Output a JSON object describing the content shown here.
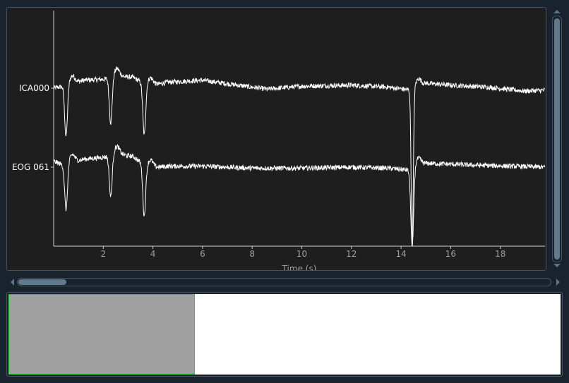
{
  "colors": {
    "background": "#19232d",
    "plot_background": "#1e1e1e",
    "trace": "#ffffff",
    "axis": "#d0d0d0",
    "tick_label": "#a0a0a0",
    "scroll_handle": "#60798b",
    "overview_window": "#a0a0a0",
    "overview_window_border": "#2ecc40"
  },
  "chart_data": {
    "type": "line",
    "xlabel": "Time (s)",
    "xlim": [
      0,
      19.8
    ],
    "xticks": [
      2,
      4,
      6,
      8,
      10,
      12,
      14,
      16,
      18
    ],
    "channels": [
      "ICA000",
      "EOG 061"
    ],
    "series": [
      {
        "name": "ICA000",
        "baseline_segments": [
          {
            "x": [
              0,
              0.4,
              1.2,
              2.0,
              2.6,
              3.2,
              3.8,
              4.6,
              6,
              8,
              8.6,
              10,
              12,
              13.5,
              14.4,
              15,
              16,
              17.5,
              19,
              19.8
            ],
            "y": [
              0.0,
              0.1,
              0.4,
              0.45,
              0.6,
              0.55,
              0.1,
              0.3,
              0.4,
              0.05,
              -0.05,
              0.1,
              0.15,
              0.05,
              -0.1,
              0.25,
              0.15,
              0.05,
              -0.15,
              -0.1
            ]
          }
        ],
        "blinks": [
          {
            "t": 0.5,
            "depth": -2.6
          },
          {
            "t": 2.3,
            "depth": -2.3
          },
          {
            "t": 3.65,
            "depth": -2.6
          },
          {
            "t": 14.45,
            "depth": -8.0
          }
        ]
      },
      {
        "name": "EOG 061",
        "baseline_segments": [
          {
            "x": [
              0,
              0.4,
              1.2,
              2.0,
              2.6,
              3.2,
              3.8,
              4.6,
              6,
              8,
              10,
              12,
              13.5,
              14.3,
              15,
              17,
              19.8
            ],
            "y": [
              0.3,
              0.1,
              0.4,
              0.5,
              0.65,
              0.55,
              -0.05,
              0.05,
              0.05,
              -0.05,
              -0.05,
              0.0,
              -0.05,
              -0.15,
              0.2,
              0.1,
              0.0
            ]
          }
        ],
        "blinks": [
          {
            "t": 0.5,
            "depth": -2.3
          },
          {
            "t": 2.3,
            "depth": -2.1
          },
          {
            "t": 3.65,
            "depth": -2.6
          },
          {
            "t": 14.45,
            "depth": -4.0
          }
        ]
      }
    ]
  },
  "overview": {
    "visible_window": [
      0,
      0.335
    ]
  }
}
